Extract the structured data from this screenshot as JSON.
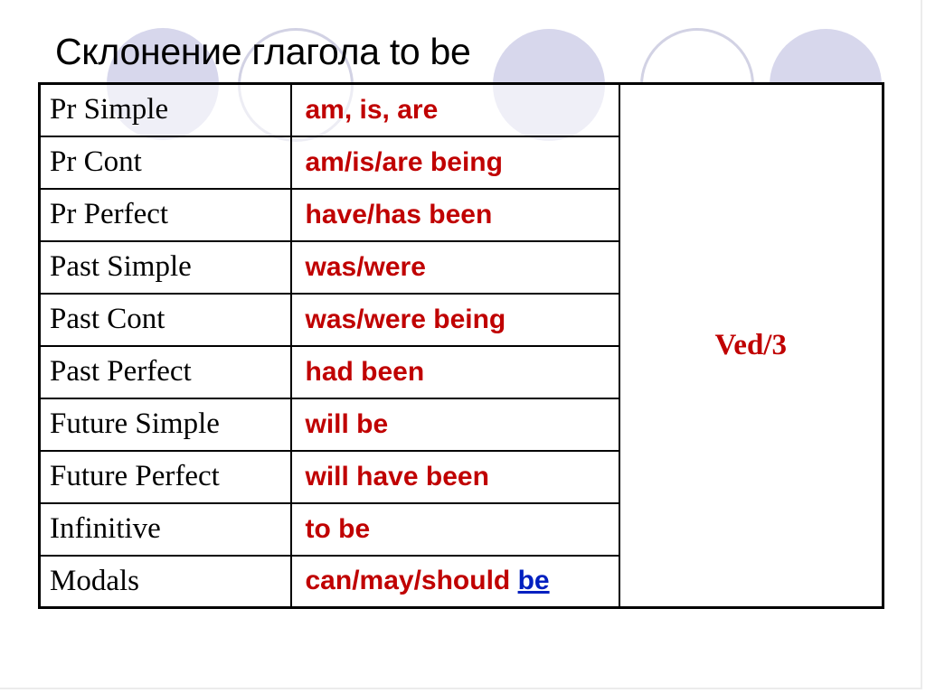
{
  "title": "Склонение глагола to be",
  "decor": {
    "circle_fill_color": "#d6d6ea",
    "circle_outline_color": "#cdcde1"
  },
  "colors": {
    "form_text": "#c00000",
    "highlight_be": "#0020c0",
    "tense_text": "#000000"
  },
  "table": {
    "participle": "Ved/3",
    "rows": [
      {
        "tense": "Pr Simple",
        "form": "am, is, are"
      },
      {
        "tense": "Pr Cont",
        "form": "am/is/are being"
      },
      {
        "tense": "Pr Perfect",
        "form": "have/has been"
      },
      {
        "tense": "Past Simple",
        "form": "was/were"
      },
      {
        "tense": "Past Cont",
        "form": "was/were being"
      },
      {
        "tense": "Past Perfect",
        "form": "had been"
      },
      {
        "tense": "Future Simple",
        "form": "will be"
      },
      {
        "tense": "Future Perfect",
        "form": "will have been"
      },
      {
        "tense": "Infinitive",
        "form": "to be"
      },
      {
        "tense": "Modals",
        "form": "can/may/should ",
        "form_highlight": "be"
      }
    ]
  }
}
